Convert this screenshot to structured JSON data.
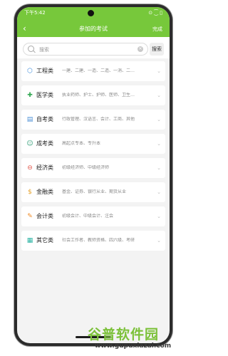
{
  "status": {
    "time": "下午5:42",
    "icons": "⊙ ⁐ ▯"
  },
  "header": {
    "back": "‹",
    "title": "参加的考试",
    "done": "完成"
  },
  "search": {
    "placeholder": "搜索",
    "button": "搜索"
  },
  "items": [
    {
      "label": "工程类",
      "desc": "一建、二建、一造、二造、一消、二…",
      "icon": "⬡",
      "color": "#3f8ddb"
    },
    {
      "label": "医学类",
      "desc": "执业药师、护士、护师、医师、卫生…",
      "icon": "✚",
      "color": "#33a853"
    },
    {
      "label": "自考类",
      "desc": "行政管理、汉语言、会计、工商、其他",
      "icon": "▤",
      "color": "#4a8ed6"
    },
    {
      "label": "成考类",
      "desc": "高起点专本、专升本",
      "icon": "☺",
      "color": "#36a07a"
    },
    {
      "label": "经济类",
      "desc": "初级经济师、中级经济师",
      "icon": "⊖",
      "color": "#e2574c"
    },
    {
      "label": "金融类",
      "desc": "基金、证券、银行从业、期货从业",
      "icon": "$",
      "color": "#e6a12a"
    },
    {
      "label": "会计类",
      "desc": "初级会计、中级会计、注会",
      "icon": "✎",
      "color": "#f08a24"
    },
    {
      "label": "其它类",
      "desc": "社会工作者、教师资格、四六级、考研",
      "icon": "▦",
      "color": "#2bb3a3"
    }
  ],
  "watermark": {
    "logo": "谷普软件园",
    "url": "www.gupuxiazai.com"
  },
  "colors": {
    "accent": "#77c83b",
    "background": "#f3f3f3"
  }
}
